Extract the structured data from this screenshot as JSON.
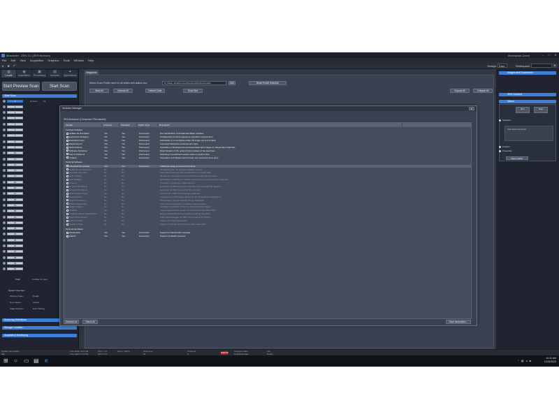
{
  "window": {
    "title": "Mosaicize - ZEN 3.1 (ZEN lite/core)",
    "workspace_label": "Workspace Zoom",
    "controls": [
      "–",
      "□",
      "✕"
    ]
  },
  "menubar": [
    "File",
    "Edit",
    "View",
    "Acquisition",
    "Graphics",
    "Tools",
    "Window",
    "Help"
  ],
  "toolbar": {
    "design_label": "Design",
    "design_value": "Dark",
    "workspace_label": "Workspace"
  },
  "left": {
    "tabs": [
      "Locate",
      "Acquisition",
      "Processing",
      "Analysis",
      "Applications"
    ],
    "start_preview": "Start Preview Scan",
    "start_scan": "Start Scan",
    "section_tray": "Slide Scan",
    "tray_rows": [
      "1",
      "2",
      "3",
      "4",
      "5",
      "6",
      "7",
      "8",
      "9",
      "10",
      "11",
      "12",
      "13",
      "14",
      "15",
      "16",
      "17",
      "18",
      "19",
      "20",
      "21",
      "22",
      "23",
      "24",
      "25",
      "26",
      "27",
      "28",
      "29",
      "30"
    ],
    "first_status": "Hi Scan",
    "first_num": "1/1",
    "total_label": "Total:",
    "total_value": "0 slides for scan",
    "system_overview": "System Overview",
    "working_state_label": "Working State:",
    "working_state": "Ready",
    "door_status_label": "Door Status:",
    "door_status": "Closed",
    "stage_position_label": "Stage Position:",
    "stage_position": "Ents Parking",
    "bottom_sections": [
      "Scanning Definitions",
      "Storage Location",
      "Acquisition Monitoring"
    ]
  },
  "main": {
    "doc_tab": "Magazine",
    "select_text": "Select Scan Profile used for all slides with status new",
    "combo_value": "FI_Nosie_Mobile Focus/Standard-Plan/Focus-Edit",
    "edit_btn": "Edit",
    "reset_btn": "Reset Profile Selection",
    "btn_mark_all": "Mark All",
    "btn_unmark_all": "Unmark All",
    "btn_default": "Default Order",
    "btn_scan_slot": "Scan Slot",
    "btn_expand": "Expand All",
    "btn_collapse": "Collapse All",
    "tray_prefix": "Tray Position:",
    "tray_position": "1",
    "type_label": "Type:",
    "type_value": "Scan(el)"
  },
  "dialog": {
    "title": "Modules Manager",
    "subtitle": "ZEN Axioscan (Consumer/ Permanent)",
    "columns": [
      "Module",
      "Licensed",
      "Activated",
      "Option Type",
      "Description"
    ],
    "group_included": "Included Software",
    "included": [
      {
        "name": "AFIEE Life Sub Basis",
        "lic": "Yes",
        "act": "Yes",
        "type": "Permanent",
        "desc": "Die Identification of AFFEE Edit Basis modules."
      },
      {
        "name": "Experiment Designer",
        "lic": "Yes",
        "act": "Yes",
        "type": "Permanent",
        "desc": "Configuration of inhomogeneous acquisition experiments"
      },
      {
        "name": "Extended Focus",
        "lic": "Yes",
        "act": "Yes",
        "type": "Permanent",
        "desc": "Calculation of a completely sharp 2D image out of a Z-stack."
      },
      {
        "name": "Measurement",
        "lic": "Yes",
        "act": "Yes",
        "type": "Permanent",
        "desc": "Advanced interactive measurement tools."
      },
      {
        "name": "Multi Channel",
        "lic": "Yes",
        "act": "Yes",
        "type": "Permanent",
        "desc": "Acquisition of fluorescence and transmitted light images in independent channels."
      },
      {
        "name": "Software Autofocus",
        "lic": "Yes",
        "act": "Yes",
        "type": "Permanent",
        "desc": "Determination of the optimal focus position of the specimen."
      },
      {
        "name": "Tiles & Positions",
        "lic": "Yes",
        "act": "Yes",
        "type": "Permanent",
        "desc": "Scanning of predefined sample areas or position lists."
      },
      {
        "name": "Z-Stack",
        "lic": "Yes",
        "act": "Yes",
        "type": "Permanent",
        "desc": "Acquisition of Z-Stacks with the help of a motorized focus drive."
      }
    ],
    "group_optional": "Optional Software",
    "optional": [
      {
        "name": "Advanced Processing",
        "lic": "Yes",
        "act": "Yes",
        "type": "Permanent",
        "desc": "Additional image processing functions.",
        "bright": true
      },
      {
        "name": "AFEE 3D Lite Extension",
        "lic": "No",
        "act": "No",
        "type": "",
        "desc": "3D Viewing plus 3D analysis (AFIEE module).",
        "bright": false
      },
      {
        "name": "Axioscan Ops Filter",
        "lic": "No",
        "act": "No",
        "type": "",
        "desc": "Automated scanning and quantification of specific data.",
        "bright": false
      },
      {
        "name": "Cell Counting",
        "lic": "No",
        "act": "No",
        "type": "",
        "desc": "Module for automated counting of fluorescently labeled nuclei.",
        "bright": false
      },
      {
        "name": "Cell Statistics",
        "lic": "No",
        "act": "No",
        "type": "",
        "desc": "Quantitative evaluation of cellular parameters over fluorescence channels.",
        "bright": false
      },
      {
        "name": "Connect",
        "lic": "No",
        "act": "No",
        "type": "",
        "desc": "Correlative workflows in ZEN connect.",
        "bright": false
      },
      {
        "name": "Connect 3D Add-on",
        "lic": "No",
        "act": "No",
        "type": "",
        "desc": "Extension for ZEN Connect to visualize and correlate 3D datasets.",
        "bright": false
      },
      {
        "name": "Connect 3D Add-on",
        "lic": "No",
        "act": "No",
        "type": "",
        "desc": "Extension for ZEN Connect for 3D volumes.",
        "bright": false
      },
      {
        "name": "Data Storage Client",
        "lic": "No",
        "act": "No",
        "type": "",
        "desc": "Connection to ZEN Data Storage database.",
        "bright": false
      },
      {
        "name": "Deconvolution",
        "lic": "No",
        "act": "No",
        "type": "",
        "desc": "Improvement of 3D image stacks via 3D deconvolution algorithms.",
        "bright": false
      },
      {
        "name": "Direct Processing",
        "lic": "No",
        "act": "No",
        "type": "",
        "desc": "Processing of images directly during acquisition.",
        "bright": false
      },
      {
        "name": "Elastix Registration",
        "lic": "No",
        "act": "No",
        "type": "",
        "desc": "Automated registration of multiple image datasets.",
        "bright": false
      },
      {
        "name": "Image Analysis",
        "lic": "No",
        "act": "No",
        "type": "",
        "desc": "Modules for analysis of color and fluorescence images.",
        "bright": false
      },
      {
        "name": "Intellesis",
        "lic": "No",
        "act": "No",
        "type": "",
        "desc": "Image segmentation based on machine learning within ZEN.",
        "bright": false
      },
      {
        "name": "Intellesis Object Classification",
        "lic": "No",
        "act": "No",
        "type": "",
        "desc": "Object classification using machine learning algorithm.",
        "bright": false
      },
      {
        "name": "Macro Environment",
        "lic": "No",
        "act": "No",
        "type": "",
        "desc": "Editor and debugger for ZEN macros based on Python.",
        "bright": false
      },
      {
        "name": "OAD Interface",
        "lic": "No",
        "act": "No",
        "type": "",
        "desc": "Support for OAD functionality.",
        "bright": false
      },
      {
        "name": "Shuttle & Find",
        "lic": "No",
        "act": "No",
        "type": "",
        "desc": "Support of Shuttle & Find functionality inside ZEN.",
        "bright": false
      }
    ],
    "group_hardware": "Optional Hardware",
    "hardware": [
      {
        "name": "Hamamatsu",
        "lic": "Yes",
        "act": "Yes",
        "type": "Permanent",
        "desc": "Support of Hamamatsu cameras."
      },
      {
        "name": "Hitachi",
        "lic": "Yes",
        "act": "Yes",
        "type": "Permanent",
        "desc": "Support of Hitachi cameras."
      }
    ],
    "btn_deselect": "Deselect All",
    "btn_select": "Select All",
    "btn_save": "Save Information..."
  },
  "right": {
    "sec_images": "Images and Documents",
    "sec_zen_connect": "ZEN Connect",
    "sec_macro": "Macro",
    "btn_run": "Run",
    "btn_stop": "Stop",
    "radio_selection": "Selection",
    "doc_label": "User Documents (0)",
    "radio_position": "Position",
    "radio_properties": "Properties",
    "macro_editor": "Macro Editor"
  },
  "status": {
    "s1": "System Information",
    "s1b": "Idle",
    "s2": "Free RAM: 24.6 GB",
    "s2b": "Free HDD: 3.75 TB",
    "s3": "CPU: 1 %",
    "s3b": "GPU: 0 %",
    "s4": "Zoom: 100 %",
    "s5": "Scan time",
    "s5b": "0s",
    "s6": "Positions",
    "s6b": "0",
    "red": "ERROR",
    "s7": "Storage Folder",
    "s7b": "Default/Storage",
    "s8": "Info",
    "s8b": "Ready"
  },
  "taskbar": {
    "time": "10:31 AM",
    "date": "11/23/2020"
  }
}
